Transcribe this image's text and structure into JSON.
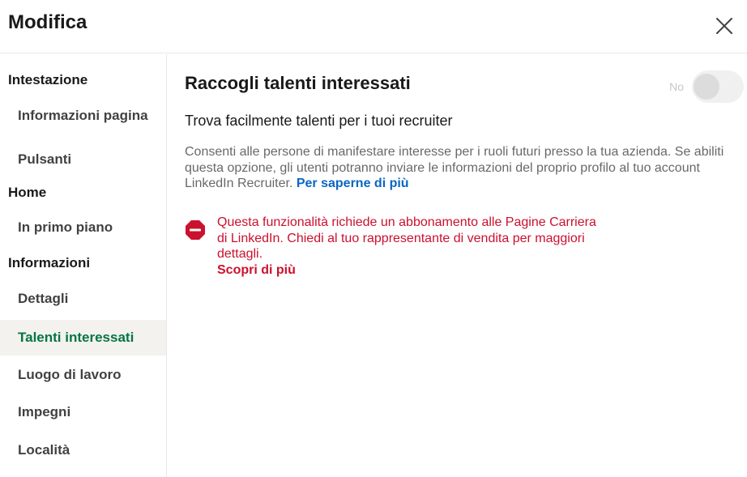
{
  "header": {
    "title": "Modifica",
    "close_icon": "close-icon"
  },
  "sidebar": {
    "groups": [
      {
        "label": "Intestazione",
        "items": [
          "Informazioni pagina",
          "Pulsanti"
        ]
      },
      {
        "label": "Home",
        "items": [
          "In primo piano"
        ]
      },
      {
        "label": "Informazioni",
        "items": [
          "Dettagli",
          "Talenti interessati",
          "Luogo di lavoro",
          "Impegni",
          "Località"
        ]
      }
    ],
    "active_item": "Talenti interessati"
  },
  "main": {
    "title": "Raccogli talenti interessati",
    "toggle": {
      "label": "No",
      "state": "off"
    },
    "subtitle": "Trova facilmente talenti per i tuoi recruiter",
    "description": "Consenti alle persone di manifestare interesse per i ruoli futuri presso la tua azienda. Se abiliti questa opzione, gli utenti potranno inviare le informazioni del proprio profilo al tuo account LinkedIn Recruiter.",
    "description_link": "Per saperne di più",
    "alert": {
      "icon": "error-icon",
      "text": "Questa funzionalità richiede un abbonamento alle Pagine Carriera di LinkedIn. Chiedi al tuo rappresentante di vendita per maggiori dettagli.",
      "link": "Scopri di più"
    }
  },
  "colors": {
    "active_green": "#057642",
    "link_blue": "#0a66c2",
    "error_red": "#cb112d",
    "active_bg": "#f3f2ef"
  }
}
